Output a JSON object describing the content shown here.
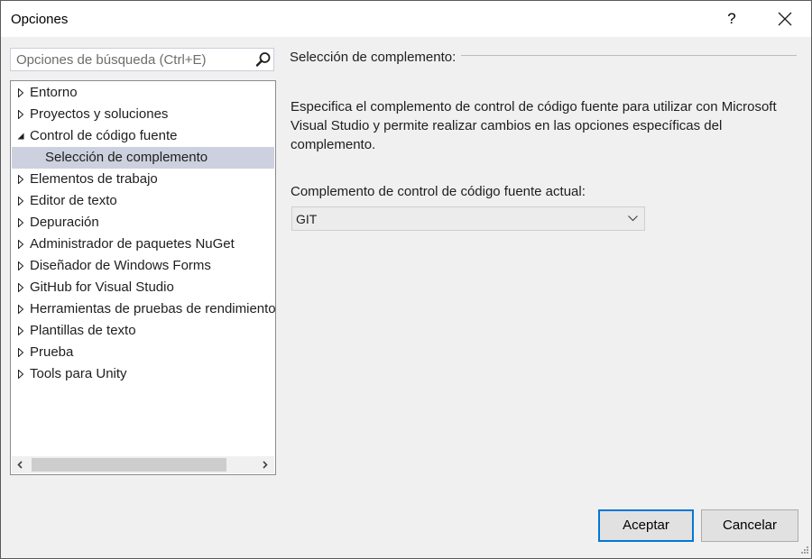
{
  "window": {
    "title": "Opciones",
    "help_label": "?"
  },
  "search": {
    "placeholder": "Opciones de búsqueda (Ctrl+E)"
  },
  "tree": {
    "items": [
      {
        "label": "Entorno",
        "expanded": false,
        "level": 0
      },
      {
        "label": "Proyectos y soluciones",
        "expanded": false,
        "level": 0
      },
      {
        "label": "Control de código fuente",
        "expanded": true,
        "level": 0
      },
      {
        "label": "Selección de complemento",
        "level": 1,
        "selected": true
      },
      {
        "label": "Elementos de trabajo",
        "expanded": false,
        "level": 0
      },
      {
        "label": "Editor de texto",
        "expanded": false,
        "level": 0
      },
      {
        "label": "Depuración",
        "expanded": false,
        "level": 0
      },
      {
        "label": "Administrador de paquetes NuGet",
        "expanded": false,
        "level": 0
      },
      {
        "label": "Diseñador de Windows Forms",
        "expanded": false,
        "level": 0
      },
      {
        "label": "GitHub for Visual Studio",
        "expanded": false,
        "level": 0
      },
      {
        "label": "Herramientas de pruebas de rendimiento",
        "expanded": false,
        "level": 0
      },
      {
        "label": "Plantillas de texto",
        "expanded": false,
        "level": 0
      },
      {
        "label": "Prueba",
        "expanded": false,
        "level": 0
      },
      {
        "label": "Tools para Unity",
        "expanded": false,
        "level": 0
      }
    ]
  },
  "panel": {
    "heading": "Selección de complemento:",
    "description": "Especifica el complemento de control de código fuente para utilizar con Microsoft Visual Studio y permite realizar cambios en las opciones específicas del complemento.",
    "field_label": "Complemento de control de código fuente actual:",
    "selected_value": "GIT"
  },
  "buttons": {
    "ok": "Aceptar",
    "cancel": "Cancelar"
  },
  "colors": {
    "accent": "#0078d7",
    "selection": "#cdd0de"
  },
  "icons": {
    "search": "search-icon",
    "close": "close-icon",
    "collapsed": "triangle-right-icon",
    "expanded": "triangle-down-icon",
    "dropdown": "chevron-down-icon"
  }
}
